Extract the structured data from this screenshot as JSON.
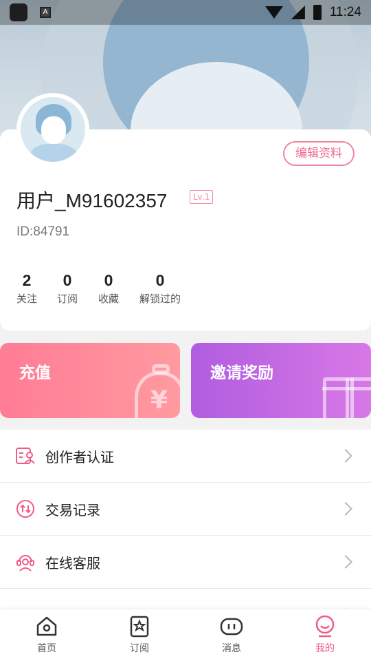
{
  "status_bar": {
    "time": "11:24",
    "notification_icon_label": "A"
  },
  "profile": {
    "edit_label": "编辑资料",
    "username": "用户_M91602357",
    "level": "Lv.1",
    "user_id": "ID:84791",
    "stats": [
      {
        "value": "2",
        "label": "关注"
      },
      {
        "value": "0",
        "label": "订阅"
      },
      {
        "value": "0",
        "label": "收藏"
      },
      {
        "value": "0",
        "label": "解锁过的"
      }
    ]
  },
  "tiles": {
    "recharge": {
      "label": "充值",
      "icon": "money-bag-icon"
    },
    "invite": {
      "label": "邀请奖励",
      "icon": "gift-icon"
    }
  },
  "menu": [
    {
      "label": "创作者认证",
      "icon": "creator-certification-icon"
    },
    {
      "label": "交易记录",
      "icon": "transaction-icon"
    },
    {
      "label": "在线客服",
      "icon": "customer-service-icon"
    }
  ],
  "tabbar": [
    {
      "label": "首页",
      "icon": "home-icon",
      "active": false
    },
    {
      "label": "订阅",
      "icon": "subscribe-icon",
      "active": false
    },
    {
      "label": "消息",
      "icon": "message-icon",
      "active": false
    },
    {
      "label": "我的",
      "icon": "profile-icon",
      "active": true
    }
  ],
  "colors": {
    "accent_pink": "#ee5b86",
    "recharge_gradient": [
      "#ff7c95",
      "#ff9aa0"
    ],
    "invite_gradient": [
      "#b05de0",
      "#d878e6"
    ]
  }
}
